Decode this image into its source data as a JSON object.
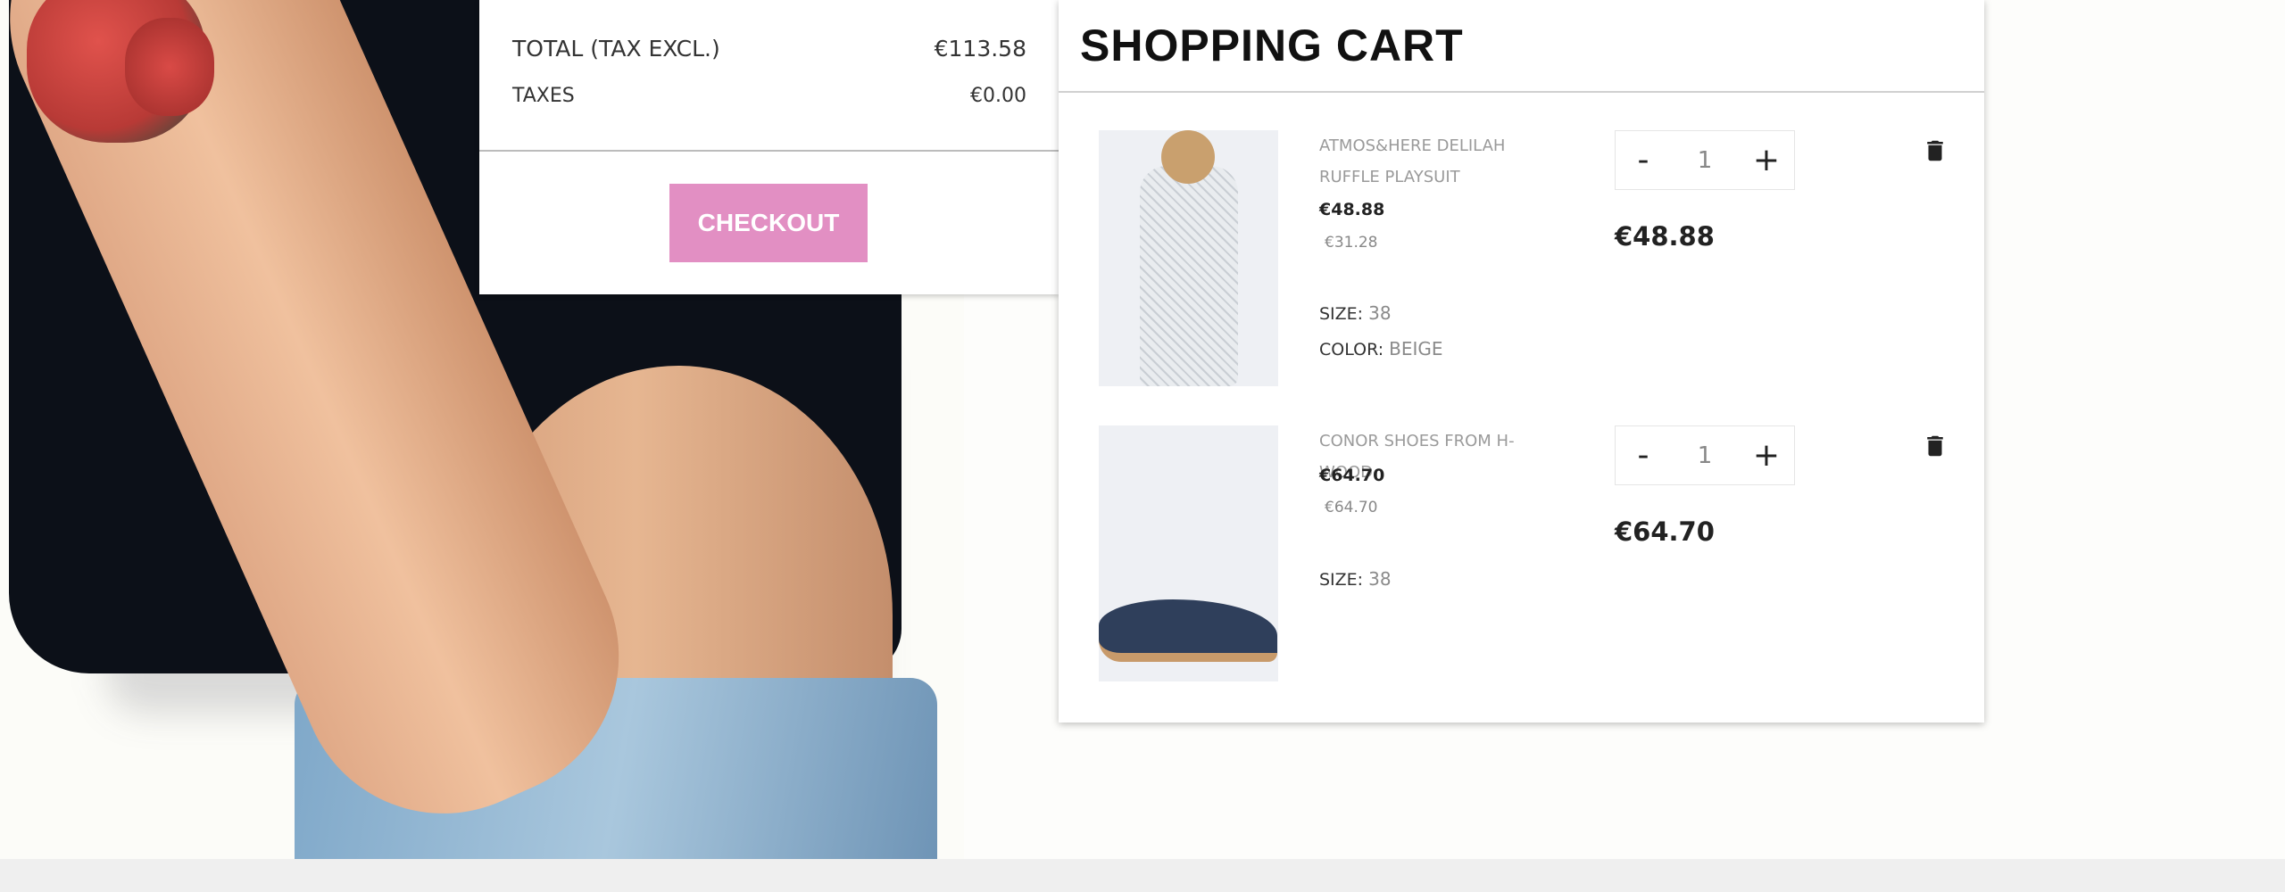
{
  "summary": {
    "total_label": "TOTAL (TAX EXCL.)",
    "total_value": "€113.58",
    "taxes_label": "TAXES",
    "taxes_value": "€0.00",
    "checkout_label": "CHECKOUT"
  },
  "cart": {
    "title": "SHOPPING CART",
    "items": [
      {
        "name": "ATMOS&HERE DELILAH RUFFLE PLAYSUIT",
        "price": "€48.88",
        "old_price": "€31.28",
        "size_label": "SIZE:",
        "size": "38",
        "color_label": "COLOR:",
        "color": "BEIGE",
        "quantity": "1",
        "minus": "-",
        "plus": "+",
        "line_total": "€48.88"
      },
      {
        "name": "CONOR SHOES FROM H-WOOD",
        "price": "€64.70",
        "old_price": "€64.70",
        "size_label": "SIZE:",
        "size": "38",
        "quantity": "1",
        "minus": "-",
        "plus": "+",
        "line_total": "€64.70"
      }
    ]
  },
  "icons": {
    "delete": "trash-icon"
  },
  "colors": {
    "checkout_button": "#e28fc3",
    "footer": "#efefef"
  }
}
